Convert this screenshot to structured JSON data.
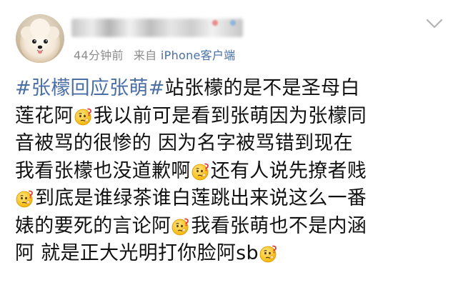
{
  "post": {
    "timestamp": "44分钟前",
    "source_prefix": "来自",
    "device": "iPhone客户端",
    "lines": [
      [
        {
          "t": "tag",
          "v": "#张檬回应张萌#"
        },
        {
          "t": "text",
          "v": "站张檬的是不是圣母白"
        }
      ],
      [
        {
          "t": "text",
          "v": "莲花阿"
        },
        {
          "t": "emoji"
        },
        {
          "t": "text",
          "v": "我以前可是看到张萌因为张檬同"
        }
      ],
      [
        {
          "t": "text",
          "v": "音被骂的很惨的 因为名字被骂错到现在"
        }
      ],
      [
        {
          "t": "text",
          "v": "我看张檬也没道歉啊"
        },
        {
          "t": "emoji"
        },
        {
          "t": "text",
          "v": "还有人说先撩者贱"
        }
      ],
      [
        {
          "t": "emoji"
        },
        {
          "t": "text",
          "v": "到底是谁绿茶谁白莲跳出来说这么一番"
        }
      ],
      [
        {
          "t": "text",
          "v": "婊的要死的言论阿"
        },
        {
          "t": "emoji"
        },
        {
          "t": "text",
          "v": "我看张萌也不是内涵"
        }
      ],
      [
        {
          "t": "text",
          "v": "阿 就是正大光明打你脸阿sb"
        },
        {
          "t": "emoji"
        }
      ]
    ]
  },
  "icons": {
    "avatar": "pomeranian-dog-avatar",
    "more": "chevron-down-icon",
    "emoji": "thinking-face-emoji"
  },
  "colors": {
    "link": "#4a6fa5",
    "meta": "#8c8c8c",
    "text": "#111111"
  }
}
